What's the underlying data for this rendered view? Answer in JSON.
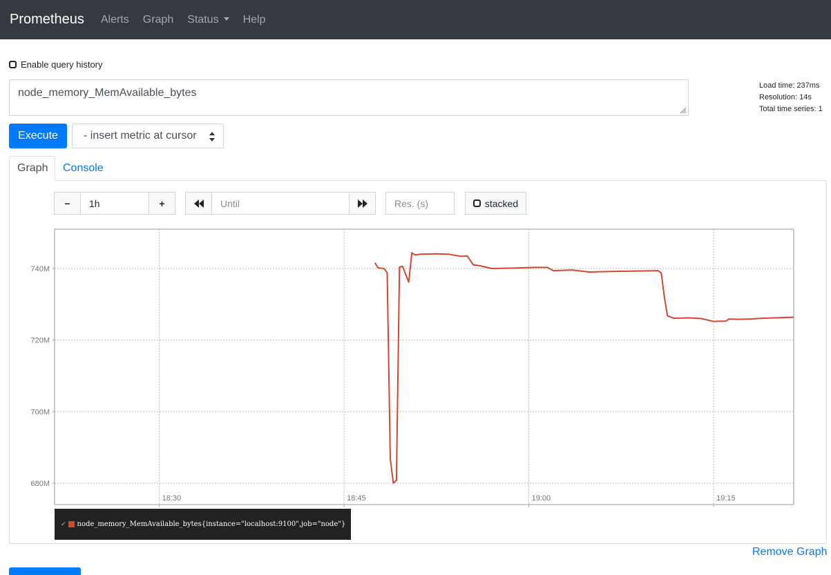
{
  "navbar": {
    "brand": "Prometheus",
    "links": {
      "alerts": "Alerts",
      "graph": "Graph",
      "status": "Status",
      "help": "Help"
    }
  },
  "query_history": {
    "label": "Enable query history",
    "checked": false
  },
  "query": {
    "expression": "node_memory_MemAvailable_bytes"
  },
  "stats": {
    "load_time": "Load time: 237ms",
    "resolution": "Resolution: 14s",
    "total_series": "Total time series: 1"
  },
  "toolbar": {
    "execute_label": "Execute",
    "metric_select_value": "- insert metric at cursor"
  },
  "tabs": {
    "graph": "Graph",
    "console": "Console",
    "active": "Graph"
  },
  "graph_controls": {
    "range_minus": "−",
    "range_value": "1h",
    "range_plus": "+",
    "until_placeholder": "Until",
    "res_placeholder": "Res. (s)",
    "stacked_label": "stacked"
  },
  "colors": {
    "series": "#d4462d",
    "accent": "#007bff",
    "navbar": "#343a40"
  },
  "chart_data": {
    "type": "line",
    "title": "",
    "xlabel": "",
    "ylabel": "",
    "x_ticks": [
      "18:30",
      "18:45",
      "19:00",
      "19:15"
    ],
    "y_ticks": [
      "680M",
      "700M",
      "720M",
      "740M"
    ],
    "xlim": [
      "18:21:30",
      "19:21:30"
    ],
    "ylim": [
      674,
      751
    ],
    "grid": true,
    "legend_position": "bottom-left",
    "series": [
      {
        "name": "node_memory_MemAvailable_bytes{instance=\"localhost:9100\",job=\"node\"}",
        "unit": "M",
        "x": [
          "18:47:30",
          "18:47:45",
          "18:48:15",
          "18:48:30",
          "18:48:45",
          "18:49:00",
          "18:49:15",
          "18:49:30",
          "18:49:45",
          "18:50:15",
          "18:50:30",
          "18:50:45",
          "18:51:00",
          "18:51:15",
          "18:52:30",
          "18:53:30",
          "18:54:30",
          "18:55:00",
          "18:55:30",
          "18:56:00",
          "18:57:00",
          "18:58:30",
          "19:00:30",
          "19:01:30",
          "19:02:00",
          "19:03:30",
          "19:05:00",
          "19:05:30",
          "19:07:00",
          "19:09:00",
          "19:10:30",
          "19:10:45",
          "19:11:00",
          "19:11:15",
          "19:11:45",
          "19:13:00",
          "19:14:00",
          "19:15:00",
          "19:15:30",
          "19:16:00",
          "19:16:15",
          "19:17:00",
          "19:18:00",
          "19:19:00",
          "19:20:00",
          "19:21:30"
        ],
        "y": [
          741.6,
          740.2,
          740.0,
          738.8,
          686.8,
          680.0,
          680.8,
          740.4,
          740.6,
          736.2,
          744.4,
          743.8,
          743.9,
          744.0,
          744.1,
          744.0,
          743.4,
          743.5,
          741.0,
          740.8,
          740.0,
          740.1,
          740.3,
          740.3,
          739.4,
          739.6,
          739.0,
          739.1,
          739.2,
          739.3,
          739.4,
          738.7,
          732.0,
          726.8,
          726.1,
          726.2,
          726.0,
          725.2,
          725.3,
          725.3,
          725.9,
          725.8,
          725.9,
          726.1,
          726.2,
          726.4
        ]
      }
    ]
  },
  "footer": {
    "remove_graph": "Remove Graph"
  }
}
